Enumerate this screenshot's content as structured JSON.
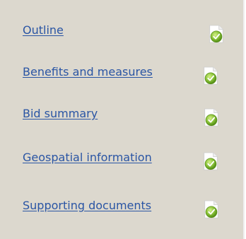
{
  "nav": {
    "items": [
      {
        "label": "Outline",
        "icon": "document-complete-icon",
        "status": "complete"
      },
      {
        "label": "Benefits and measures",
        "icon": "document-complete-icon",
        "status": "complete"
      },
      {
        "label": "Bid summary",
        "icon": "document-complete-icon",
        "status": "complete"
      },
      {
        "label": "Geospatial information",
        "icon": "document-complete-icon",
        "status": "complete"
      },
      {
        "label": "Supporting documents",
        "icon": "document-complete-icon",
        "status": "complete"
      }
    ]
  },
  "colors": {
    "panel_background": "#dcd8ce",
    "link": "#2a55a4",
    "check_green": "#7cb22a"
  }
}
